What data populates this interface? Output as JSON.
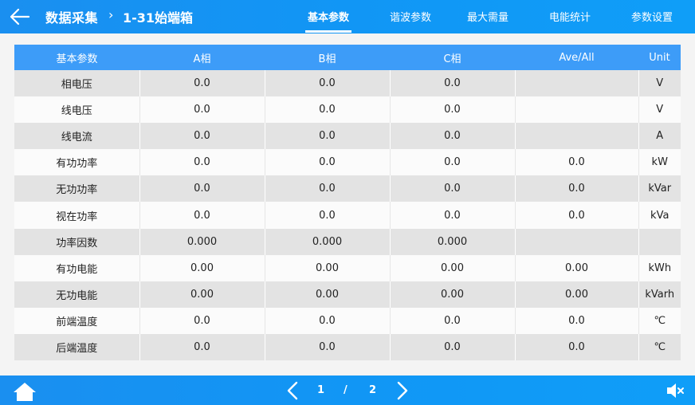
{
  "header": {
    "title": "数据采集",
    "crumb_sep": "›",
    "crumb": "1-31始端箱",
    "tabs": [
      {
        "label": "基本参数",
        "active": true
      },
      {
        "label": "谐波参数",
        "active": false
      },
      {
        "label": "最大需量",
        "active": false
      },
      {
        "label": "电能统计",
        "active": false
      },
      {
        "label": "参数设置",
        "active": false
      }
    ]
  },
  "table": {
    "columns": [
      "基本参数",
      "A相",
      "B相",
      "C相",
      "Ave/All",
      "Unit"
    ],
    "rows": [
      [
        "相电压",
        "0.0",
        "0.0",
        "0.0",
        "",
        "V"
      ],
      [
        "线电压",
        "0.0",
        "0.0",
        "0.0",
        "",
        "V"
      ],
      [
        "线电流",
        "0.0",
        "0.0",
        "0.0",
        "",
        "A"
      ],
      [
        "有功功率",
        "0.0",
        "0.0",
        "0.0",
        "0.0",
        "kW"
      ],
      [
        "无功功率",
        "0.0",
        "0.0",
        "0.0",
        "0.0",
        "kVar"
      ],
      [
        "视在功率",
        "0.0",
        "0.0",
        "0.0",
        "0.0",
        "kVa"
      ],
      [
        "功率因数",
        "0.000",
        "0.000",
        "0.000",
        "",
        ""
      ],
      [
        "有功电能",
        "0.00",
        "0.00",
        "0.00",
        "0.00",
        "kWh"
      ],
      [
        "无功电能",
        "0.00",
        "0.00",
        "0.00",
        "0.00",
        "kVarh"
      ],
      [
        "前端温度",
        "0.0",
        "0.0",
        "0.0",
        "0.0",
        "℃"
      ],
      [
        "后端温度",
        "0.0",
        "0.0",
        "0.0",
        "0.0",
        "℃"
      ]
    ]
  },
  "footer": {
    "page_current": "1",
    "page_sep": "/",
    "page_total": "2"
  },
  "colors": {
    "bar": "#1196f5",
    "header_row": "#3d9cf8",
    "stripe": "#e3e3e3"
  },
  "icons": [
    "back-arrow-icon",
    "home-icon",
    "chevron-left-icon",
    "chevron-right-icon",
    "speaker-mute-icon"
  ]
}
